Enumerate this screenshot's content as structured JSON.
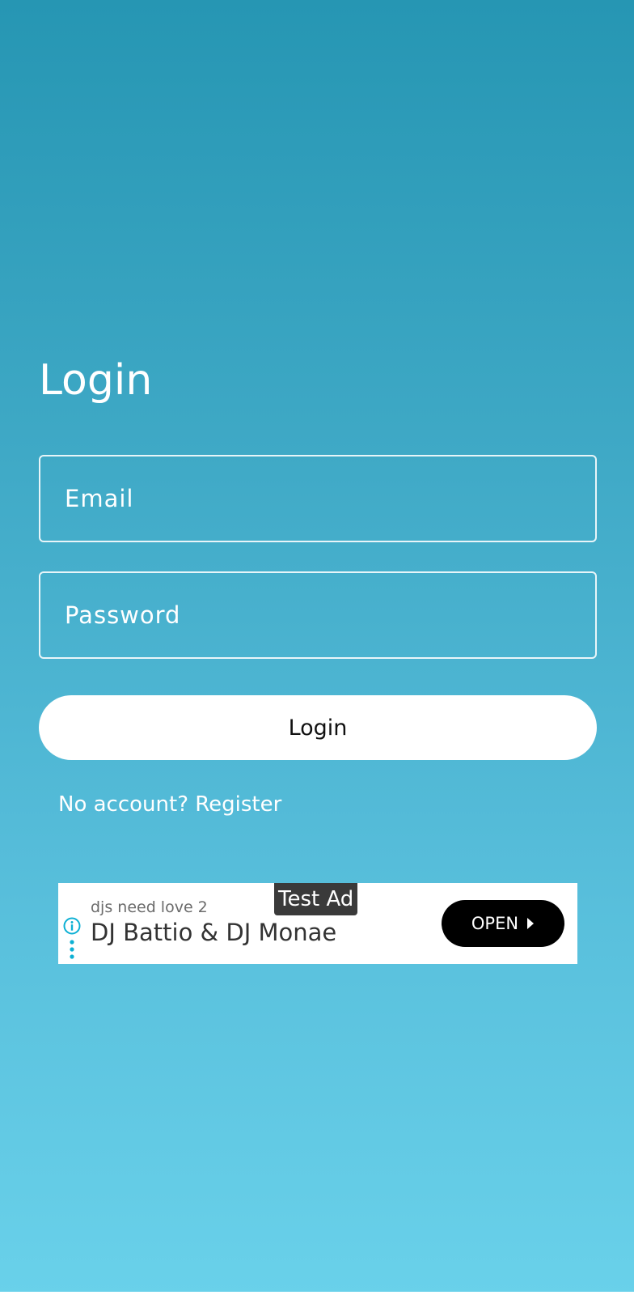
{
  "login": {
    "title": "Login",
    "email_placeholder": "Email",
    "password_placeholder": "Password",
    "submit_label": "Login",
    "register_link": "No account? Register"
  },
  "ad": {
    "label": "Test Ad",
    "subtitle": "djs need love 2",
    "title": "DJ Battio & DJ Monae",
    "cta": "OPEN",
    "info_icon": "info-icon",
    "more_icon": "more-vertical-icon",
    "accent_color": "#0db0d4"
  },
  "colors": {
    "background_top": "#2696b3",
    "background_bottom": "#69d1ea",
    "text": "#ffffff"
  }
}
